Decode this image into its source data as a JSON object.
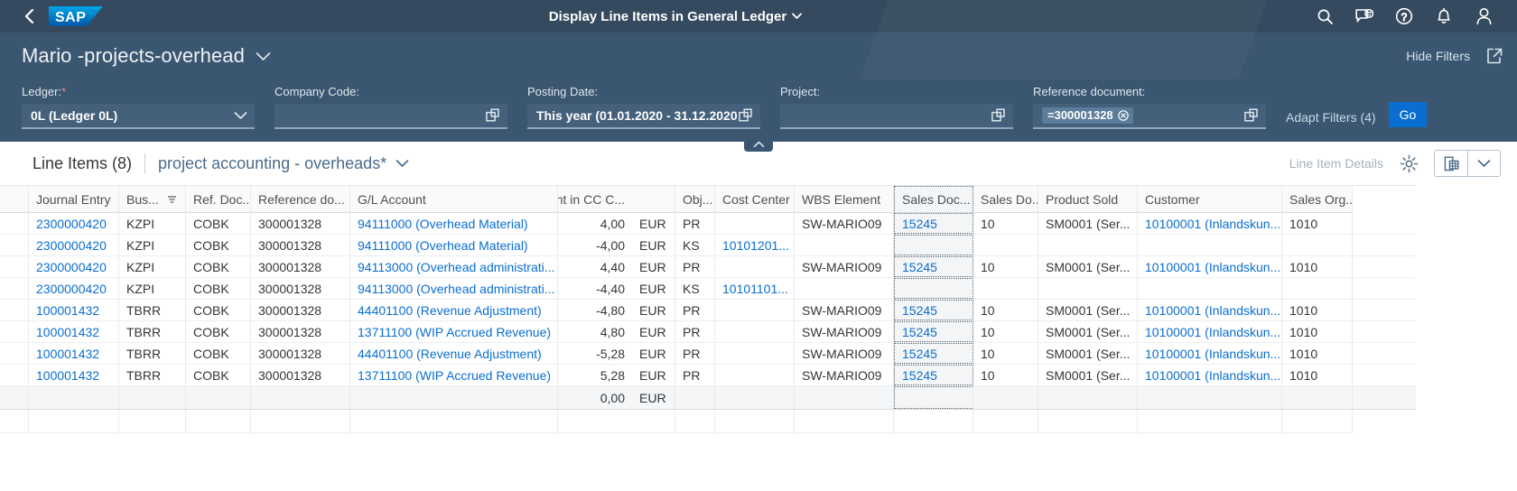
{
  "shell": {
    "app_title": "Display Line Items in General Ledger",
    "back_icon": "back-chevron-icon",
    "logo_text": "SAP",
    "icons": [
      {
        "name": "search-icon",
        "label": "Search"
      },
      {
        "name": "feedback-icon",
        "label": "Feedback"
      },
      {
        "name": "help-icon",
        "label": "Help"
      },
      {
        "name": "notifications-bell-icon",
        "label": "Notifications"
      },
      {
        "name": "user-avatar-icon",
        "label": "User"
      }
    ]
  },
  "variant_bar": {
    "title": "Mario -projects-overhead",
    "hide_filters": "Hide Filters",
    "share_icon": "share-icon"
  },
  "filters": {
    "fields": [
      {
        "name": "ledger",
        "label": "Ledger:",
        "required": true,
        "value": "0L (Ledger 0L)",
        "placeholder": "",
        "control": "dropdown"
      },
      {
        "name": "company-code",
        "label": "Company Code:",
        "required": false,
        "value": "",
        "placeholder": "",
        "control": "valuehelp"
      },
      {
        "name": "posting-date",
        "label": "Posting Date:",
        "required": false,
        "value": "This year (01.01.2020 - 31.12.2020)",
        "placeholder": "",
        "control": "valuehelp"
      },
      {
        "name": "project",
        "label": "Project:",
        "required": false,
        "value": "",
        "placeholder": "",
        "control": "valuehelp"
      },
      {
        "name": "reference-document",
        "label": "Reference document:",
        "required": false,
        "value": "",
        "token": "=300001328",
        "placeholder": "",
        "control": "valuehelp"
      }
    ],
    "adapt_filters": "Adapt Filters (4)",
    "go_label": "Go"
  },
  "table_toolbar": {
    "line_items_count": "Line Items (8)",
    "variant_name": "project accounting - overheads*",
    "line_item_details": "Line Item Details",
    "settings_icon": "gear-icon",
    "view_icon": "table-view-icon",
    "view_dropdown_icon": "chevron-down-icon"
  },
  "table": {
    "columns": [
      {
        "key": "journal",
        "label": "Journal Entry"
      },
      {
        "key": "bus",
        "label": "Bus...",
        "sorted": true
      },
      {
        "key": "refdoc",
        "label": "Ref. Doc..."
      },
      {
        "key": "refno",
        "label": "Reference do..."
      },
      {
        "key": "gl",
        "label": "G/L Account"
      },
      {
        "key": "amount",
        "label": "Amount in CC C..."
      },
      {
        "key": "obj",
        "label": "Obj..."
      },
      {
        "key": "cc",
        "label": "Cost Center"
      },
      {
        "key": "wbs",
        "label": "WBS Element"
      },
      {
        "key": "sdoc",
        "label": "Sales Doc...",
        "focused": true
      },
      {
        "key": "sdi",
        "label": "Sales Do..."
      },
      {
        "key": "prod",
        "label": "Product Sold"
      },
      {
        "key": "cust",
        "label": "Customer"
      },
      {
        "key": "sorg",
        "label": "Sales Org..."
      }
    ],
    "rows": [
      {
        "journal": "2300000420",
        "bus": "KZPI",
        "refdoc": "COBK",
        "refno": "300001328",
        "gl": "94111000 (Overhead Material)",
        "amount": "4,00",
        "currency": "EUR",
        "obj": "PR",
        "cc": "",
        "wbs": "SW-MARIO09",
        "sdoc": "15245",
        "sdi": "10",
        "prod": "SM0001 (Ser...",
        "cust": "10100001 (Inlandskun...",
        "sorg": "1010"
      },
      {
        "journal": "2300000420",
        "bus": "KZPI",
        "refdoc": "COBK",
        "refno": "300001328",
        "gl": "94111000 (Overhead Material)",
        "amount": "-4,00",
        "currency": "EUR",
        "obj": "KS",
        "cc": "10101201...",
        "wbs": "",
        "sdoc": "",
        "sdi": "",
        "prod": "",
        "cust": "",
        "sorg": ""
      },
      {
        "journal": "2300000420",
        "bus": "KZPI",
        "refdoc": "COBK",
        "refno": "300001328",
        "gl": "94113000 (Overhead administrati...",
        "amount": "4,40",
        "currency": "EUR",
        "obj": "PR",
        "cc": "",
        "wbs": "SW-MARIO09",
        "sdoc": "15245",
        "sdi": "10",
        "prod": "SM0001 (Ser...",
        "cust": "10100001 (Inlandskun...",
        "sorg": "1010"
      },
      {
        "journal": "2300000420",
        "bus": "KZPI",
        "refdoc": "COBK",
        "refno": "300001328",
        "gl": "94113000 (Overhead administrati...",
        "amount": "-4,40",
        "currency": "EUR",
        "obj": "KS",
        "cc": "10101101...",
        "wbs": "",
        "sdoc": "",
        "sdi": "",
        "prod": "",
        "cust": "",
        "sorg": ""
      },
      {
        "journal": "100001432",
        "bus": "TBRR",
        "refdoc": "COBK",
        "refno": "300001328",
        "gl": "44401100 (Revenue Adjustment)",
        "amount": "-4,80",
        "currency": "EUR",
        "obj": "PR",
        "cc": "",
        "wbs": "SW-MARIO09",
        "sdoc": "15245",
        "sdi": "10",
        "prod": "SM0001 (Ser...",
        "cust": "10100001 (Inlandskun...",
        "sorg": "1010"
      },
      {
        "journal": "100001432",
        "bus": "TBRR",
        "refdoc": "COBK",
        "refno": "300001328",
        "gl": "13711100 (WIP Accrued Revenue)",
        "amount": "4,80",
        "currency": "EUR",
        "obj": "PR",
        "cc": "",
        "wbs": "SW-MARIO09",
        "sdoc": "15245",
        "sdi": "10",
        "prod": "SM0001 (Ser...",
        "cust": "10100001 (Inlandskun...",
        "sorg": "1010"
      },
      {
        "journal": "100001432",
        "bus": "TBRR",
        "refdoc": "COBK",
        "refno": "300001328",
        "gl": "44401100 (Revenue Adjustment)",
        "amount": "-5,28",
        "currency": "EUR",
        "obj": "PR",
        "cc": "",
        "wbs": "SW-MARIO09",
        "sdoc": "15245",
        "sdi": "10",
        "prod": "SM0001 (Ser...",
        "cust": "10100001 (Inlandskun...",
        "sorg": "1010"
      },
      {
        "journal": "100001432",
        "bus": "TBRR",
        "refdoc": "COBK",
        "refno": "300001328",
        "gl": "13711100 (WIP Accrued Revenue)",
        "amount": "5,28",
        "currency": "EUR",
        "obj": "PR",
        "cc": "",
        "wbs": "SW-MARIO09",
        "sdoc": "15245",
        "sdi": "10",
        "prod": "SM0001 (Ser...",
        "cust": "10100001 (Inlandskun...",
        "sorg": "1010"
      }
    ],
    "total": {
      "amount": "0,00",
      "currency": "EUR"
    }
  },
  "colors": {
    "shell_bg": "#354a5f",
    "filter_bg": "#3b5670",
    "accent_link": "#0a6ed1",
    "go_button": "#0a6ed1",
    "required_star": "#ee8888"
  }
}
